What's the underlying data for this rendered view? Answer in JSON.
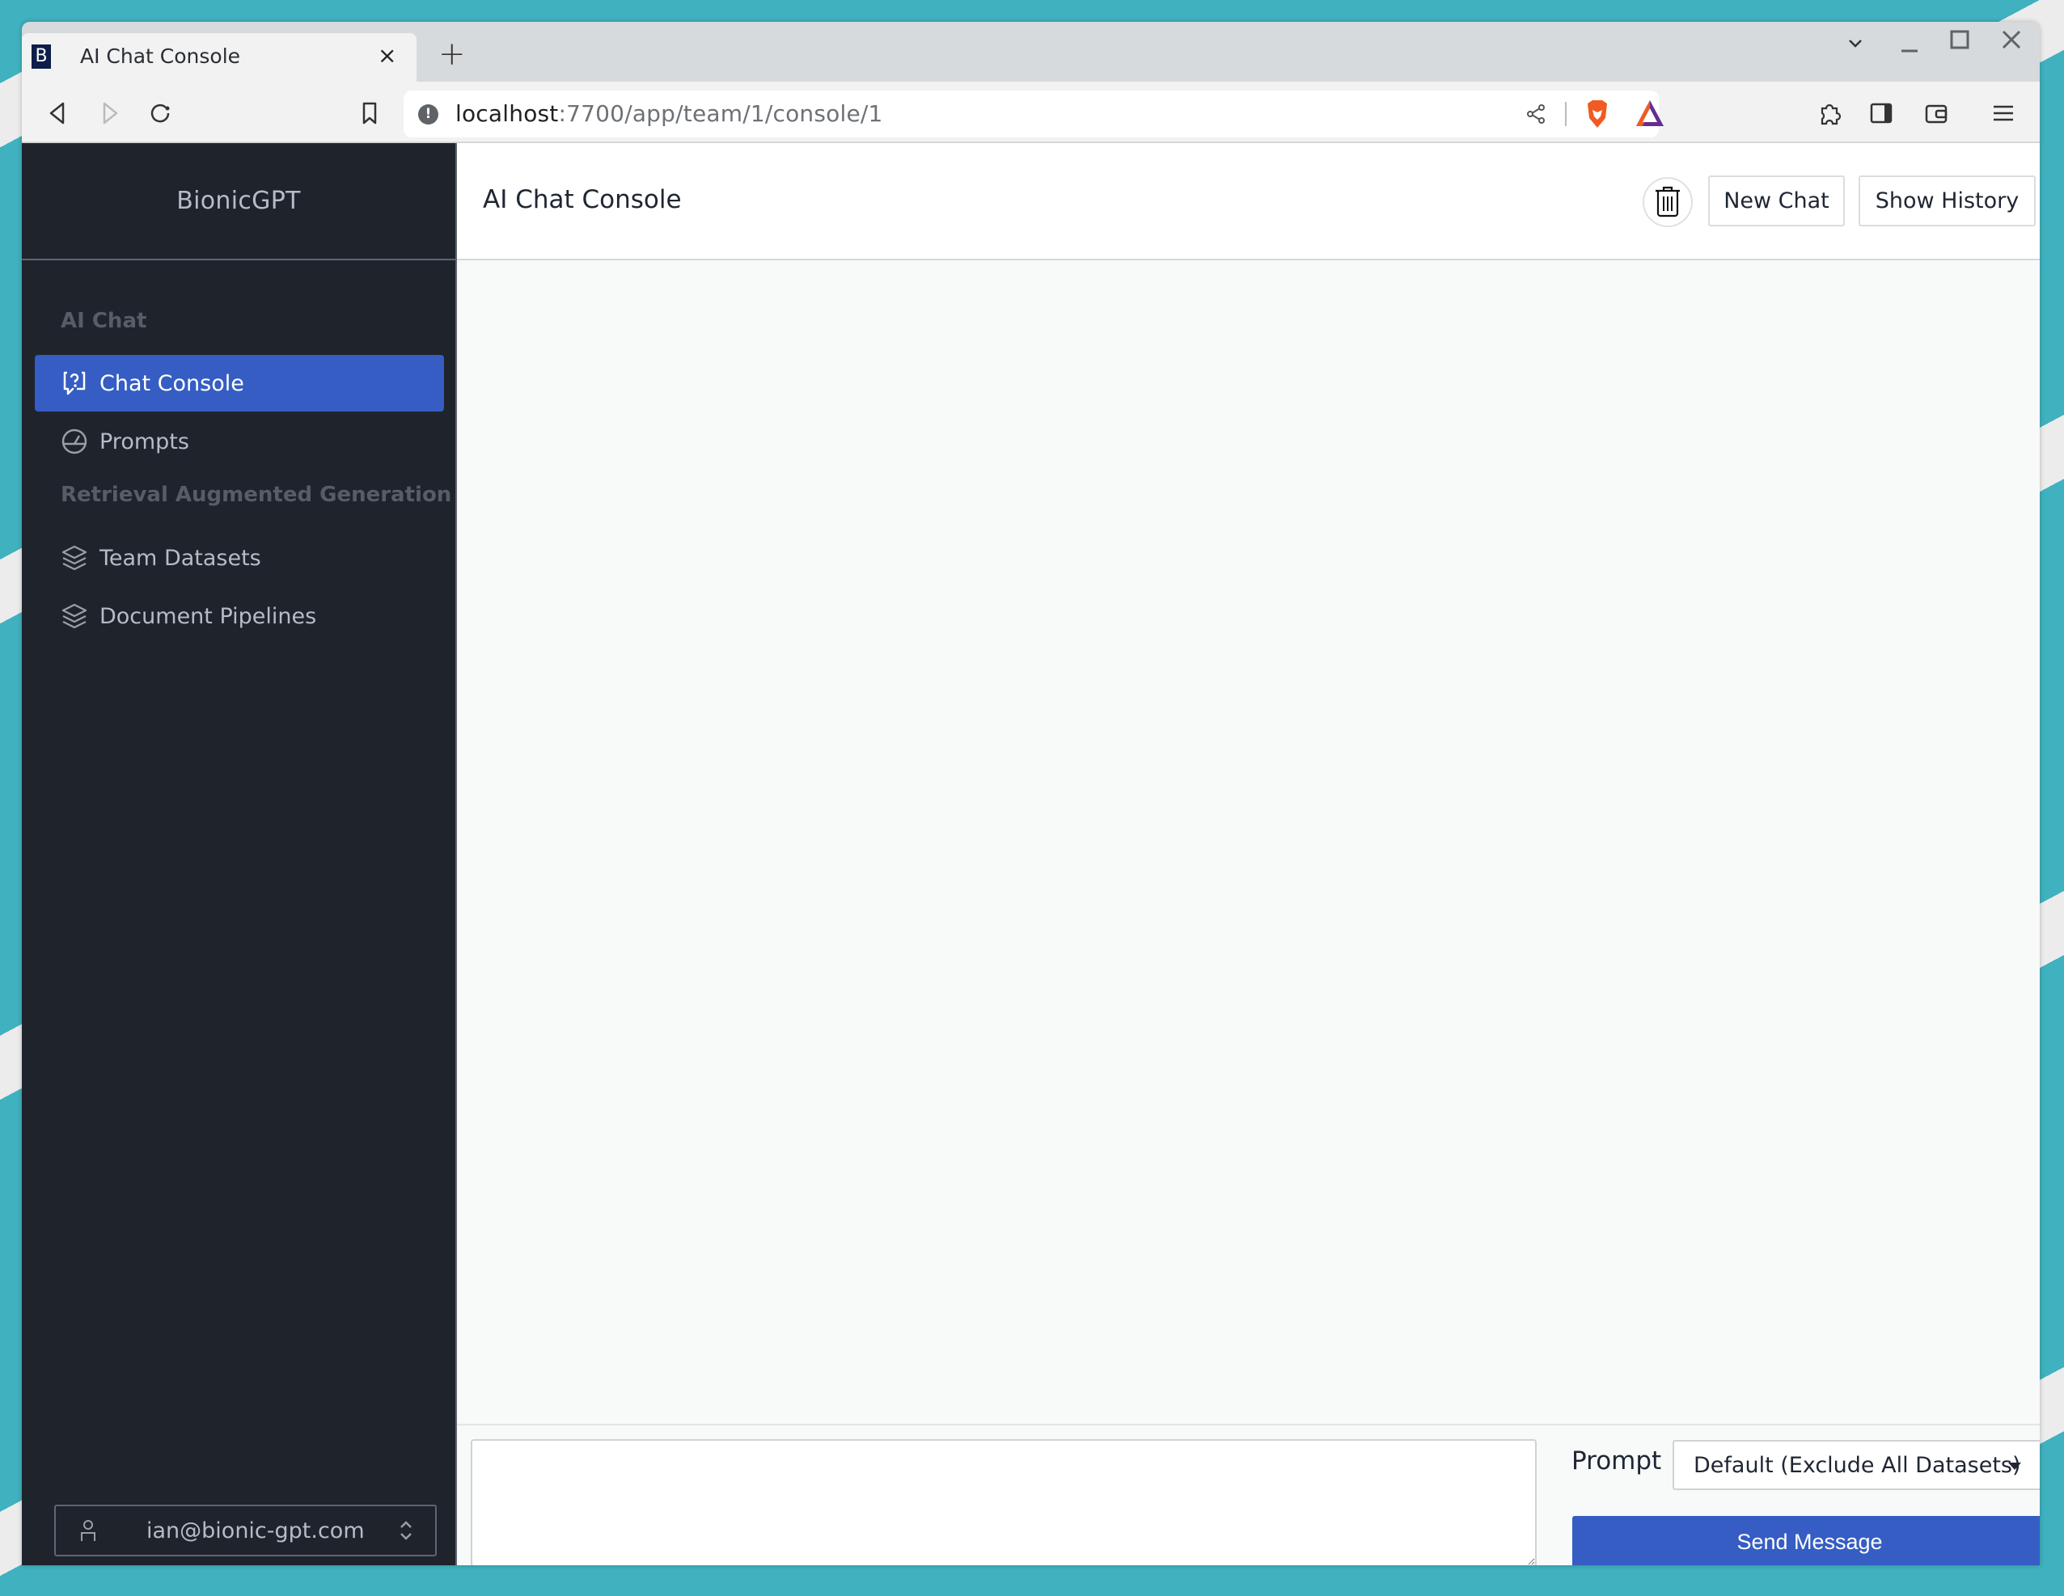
{
  "browser": {
    "tab_title": "AI Chat Console",
    "tab_favicon_letter": "B",
    "tab_close": "×",
    "new_tab": "+",
    "url_host": "localhost",
    "url_path": ":7700/app/team/1/console/1",
    "window_controls": {
      "dropdown": "⌄",
      "minimize": "–",
      "maximize": "□",
      "close": "✕"
    }
  },
  "sidebar": {
    "brand": "BionicGPT",
    "sections": [
      {
        "title": "AI Chat",
        "items": [
          {
            "label": "Chat Console",
            "icon": "chat-question-icon",
            "active": true
          },
          {
            "label": "Prompts",
            "icon": "gauge-icon",
            "active": false
          }
        ]
      },
      {
        "title": "Retrieval Augmented Generation",
        "items": [
          {
            "label": "Team Datasets",
            "icon": "layers-icon",
            "active": false
          },
          {
            "label": "Document Pipelines",
            "icon": "layers-icon",
            "active": false
          }
        ]
      }
    ],
    "user": {
      "email": "ian@bionic-gpt.com",
      "icon": "user-icon"
    }
  },
  "main": {
    "title": "AI Chat Console",
    "actions": {
      "delete_icon": "trash-icon",
      "new_chat": "New Chat",
      "show_history": "Show History"
    },
    "form": {
      "message_value": "",
      "prompt_label": "Prompt",
      "prompt_selected": "Default (Exclude All Datasets)",
      "send_label": "Send Message"
    }
  },
  "colors": {
    "accent": "#355dc3",
    "sidebar_bg": "#1f232b",
    "background": "#3fb1bf"
  }
}
